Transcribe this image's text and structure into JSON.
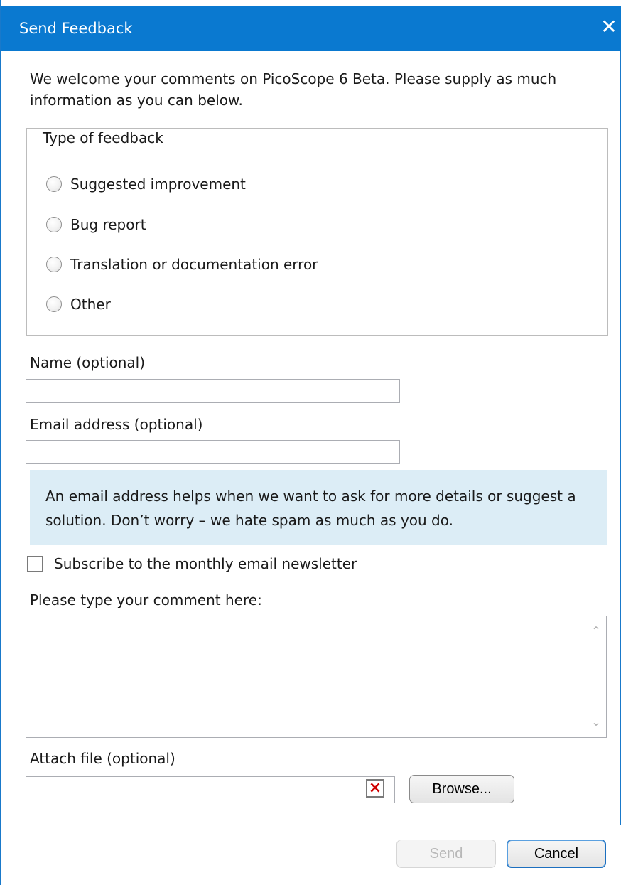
{
  "window": {
    "title": "Send Feedback",
    "close_glyph": "✕",
    "colors": {
      "titlebar": "#0a79d0",
      "info_background": "#dcedf6",
      "clear_icon": "#d00000"
    }
  },
  "intro": "We welcome your comments on PicoScope 6 Beta. Please supply as much information as you can below.",
  "feedback_type": {
    "legend": "Type of feedback",
    "options": [
      {
        "label": "Suggested improvement",
        "selected": false
      },
      {
        "label": "Bug report",
        "selected": false
      },
      {
        "label": "Translation or documentation error",
        "selected": false
      },
      {
        "label": "Other",
        "selected": false
      }
    ]
  },
  "name": {
    "label": "Name (optional)",
    "value": ""
  },
  "email": {
    "label": "Email address (optional)",
    "value": ""
  },
  "info": "An email address helps when we want to ask for more details or suggest a solution. Don’t worry – we hate spam as much as you do.",
  "newsletter": {
    "label": "Subscribe to the monthly email newsletter",
    "checked": false
  },
  "comment": {
    "label": "Please type your comment here:",
    "value": ""
  },
  "attach": {
    "label": "Attach file (optional)",
    "value": "",
    "clear_icon": "clear-x-icon",
    "browse_label": "Browse..."
  },
  "buttons": {
    "send": "Send",
    "cancel": "Cancel"
  }
}
